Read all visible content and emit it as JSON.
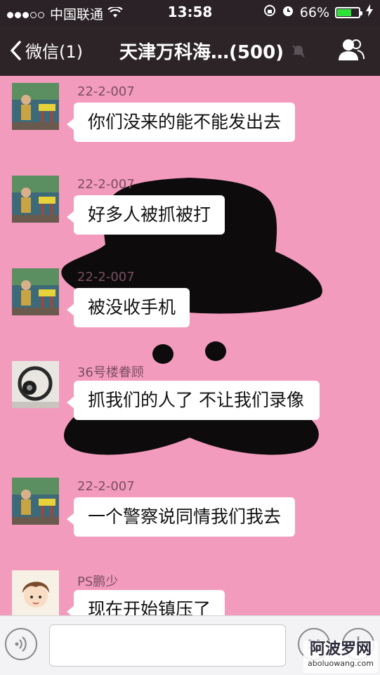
{
  "status_bar": {
    "carrier": "中国联通",
    "time": "13:58",
    "battery": "66%",
    "battery_level": 0.66,
    "battery_color": "#2fe23a"
  },
  "nav": {
    "back_label": "微信(1)",
    "title": "天津万科海…(500)"
  },
  "messages": [
    {
      "sender": "22-2-007",
      "text": "你们没来的能不能发出去",
      "avatar": "child-photo-avatar"
    },
    {
      "sender": "22-2-007",
      "text": "好多人被抓被打",
      "avatar": "child-photo-avatar"
    },
    {
      "sender": "22-2-007",
      "text": "被没收手机",
      "avatar": "child-photo-avatar"
    },
    {
      "sender": "36号楼眷顾",
      "text": "抓我们的人了 不让我们录像",
      "avatar": "headphones-photo-avatar"
    },
    {
      "sender": "22-2-007",
      "text": "一个警察说同情我们我去",
      "avatar": "child-photo-avatar"
    },
    {
      "sender": "PS鹏少",
      "text": "现在开始镇压了",
      "avatar": "cartoon-boy-avatar"
    }
  ],
  "watermark": {
    "line1": "阿波罗网",
    "line2": "aboluowang.com"
  },
  "colors": {
    "chat_background": "#f39bbd",
    "nav_background": "#2d2428",
    "bubble": "#ffffff"
  }
}
